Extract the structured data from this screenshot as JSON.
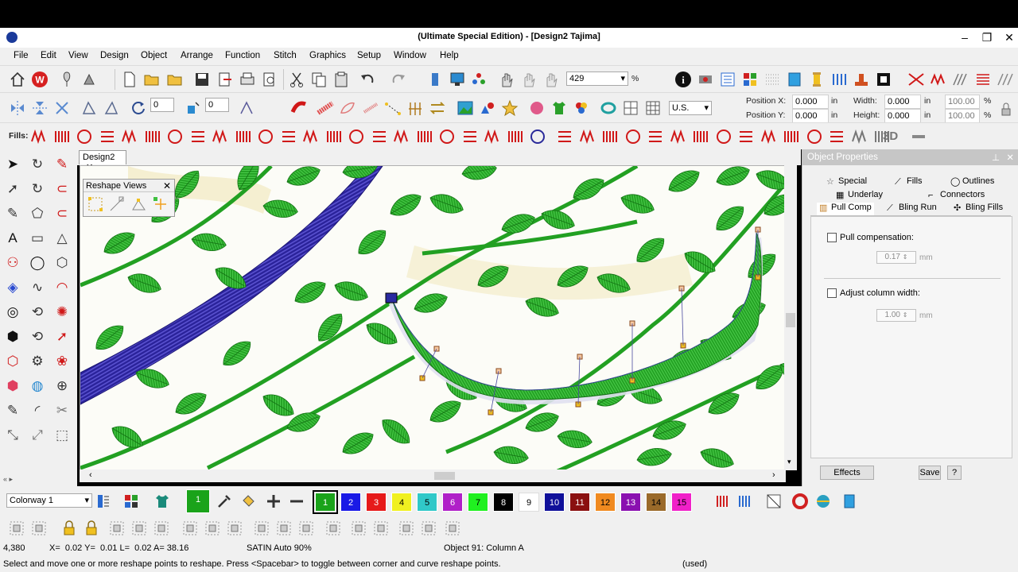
{
  "window": {
    "title": "(Ultimate Special Edition) - [Design2          Tajima]",
    "minimize": "–",
    "restore": "❐",
    "close": "✕"
  },
  "menu": [
    "File",
    "Edit",
    "View",
    "Design",
    "Object",
    "Arrange",
    "Function",
    "Stitch",
    "Graphics",
    "Setup",
    "Window",
    "Help"
  ],
  "toolbar": {
    "zoom_value": "429",
    "zoom_unit": "%",
    "field_a": "0",
    "field_b": "0",
    "unit_select": "U.S.",
    "position_x_label": "Position X:",
    "position_x_value": "0.000",
    "position_y_label": "Position Y:",
    "position_y_value": "0.000",
    "unit_in": "in",
    "width_label": "Width:",
    "width_value": "0.000",
    "height_label": "Height:",
    "height_value": "0.000",
    "scale_w": "100.00",
    "scale_h": "100.00",
    "pct": "%"
  },
  "fills_label": "Fills:",
  "fills_3d": "3D",
  "document": {
    "tab_label": "Design2",
    "tab_close": "✕"
  },
  "reshape_views": {
    "title": "Reshape Views",
    "close": "✕"
  },
  "object_properties": {
    "title": "Object Properties",
    "tabs": {
      "special": "Special",
      "fills": "Fills",
      "outlines": "Outlines",
      "underlay": "Underlay",
      "connectors": "Connectors",
      "pull_comp": "Pull Comp",
      "bling_run": "Bling Run",
      "bling_fills": "Bling Fills"
    },
    "pull_compensation_label": "Pull compensation:",
    "pull_compensation_value": "0.17",
    "adjust_column_label": "Adjust column width:",
    "adjust_column_value": "1.00",
    "unit": "mm",
    "effects_button": "Effects",
    "save_button": "Save",
    "help_button": "?"
  },
  "colorway": {
    "select": "Colorway 1",
    "swatches": [
      {
        "n": "1",
        "c": "#1aa31a",
        "fg": "#ffffff"
      },
      {
        "n": "1",
        "c": "#1aa31a",
        "fg": "#ffffff"
      },
      {
        "n": "2",
        "c": "#1a1ae6",
        "fg": "#ffffff"
      },
      {
        "n": "3",
        "c": "#e61a1a",
        "fg": "#ffffff"
      },
      {
        "n": "4",
        "c": "#f0f020",
        "fg": "#000000"
      },
      {
        "n": "5",
        "c": "#30c8c8",
        "fg": "#000000"
      },
      {
        "n": "6",
        "c": "#b020c8",
        "fg": "#ffffff"
      },
      {
        "n": "7",
        "c": "#20f020",
        "fg": "#000000"
      },
      {
        "n": "8",
        "c": "#000000",
        "fg": "#ffffff"
      },
      {
        "n": "9",
        "c": "#ffffff",
        "fg": "#000000"
      },
      {
        "n": "10",
        "c": "#10109a",
        "fg": "#ffffff"
      },
      {
        "n": "11",
        "c": "#8a1010",
        "fg": "#ffffff"
      },
      {
        "n": "12",
        "c": "#f08a20",
        "fg": "#000000"
      },
      {
        "n": "13",
        "c": "#8a10b0",
        "fg": "#ffffff"
      },
      {
        "n": "14",
        "c": "#9a6a2a",
        "fg": "#000000"
      },
      {
        "n": "15",
        "c": "#f020c8",
        "fg": "#000000"
      }
    ]
  },
  "status": {
    "stitch_count": "4,380",
    "coords": "X=  0.02 Y=  0.01 L=  0.02 A= 38.16",
    "stitch_type": "SATIN Auto 90%",
    "object": "Object 91: Column A",
    "hint": "Select and move one or more reshape points to reshape. Press <Spacebar> to toggle between corner and curve reshape points.",
    "used": "(used)"
  },
  "colors": {
    "leaf": "#22a022",
    "blue_band": "#2a229a",
    "accent_red": "#d01818"
  }
}
